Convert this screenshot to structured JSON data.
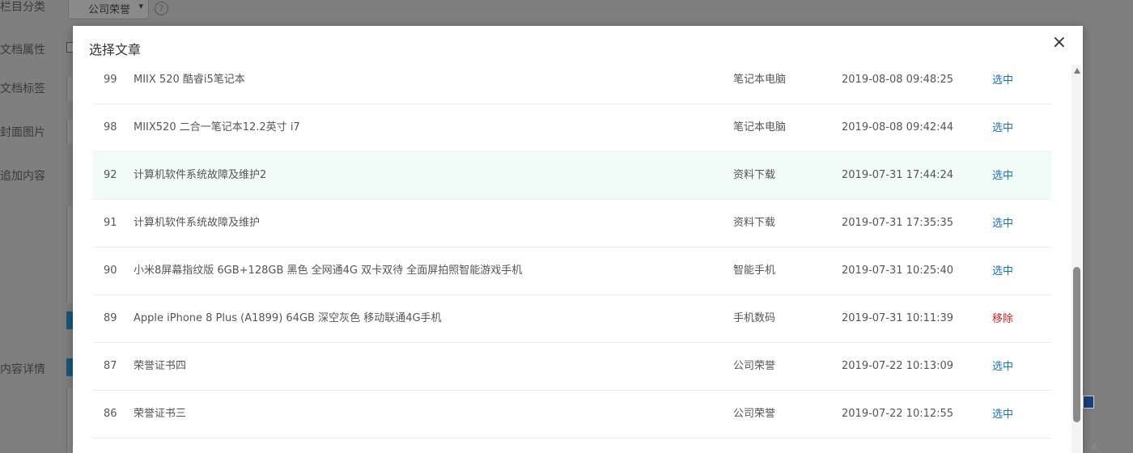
{
  "background": {
    "labels": [
      "栏目分类",
      "文档属性",
      "文档标签",
      "封面图片",
      "追加内容",
      "内容详情"
    ],
    "category_select": "公司荣誉",
    "help_icon": "question-circle-icon"
  },
  "modal": {
    "title": "选择文章",
    "close_icon": "×"
  },
  "articles": [
    {
      "id": "99",
      "title": "MIIX 520 酷睿i5笔记本",
      "category": "笔记本电脑",
      "date": "2019-08-08 09:48:25",
      "action": "选中"
    },
    {
      "id": "98",
      "title": "MIIX520 二合一笔记本12.2英寸 i7",
      "category": "笔记本电脑",
      "date": "2019-08-08 09:42:44",
      "action": "选中"
    },
    {
      "id": "92",
      "title": "计算机软件系统故障及维护2",
      "category": "资料下载",
      "date": "2019-07-31 17:44:24",
      "action": "选中"
    },
    {
      "id": "91",
      "title": "计算机软件系统故障及维护",
      "category": "资料下载",
      "date": "2019-07-31 17:35:35",
      "action": "选中"
    },
    {
      "id": "90",
      "title": "小米8屏幕指纹版 6GB+128GB 黑色 全网通4G 双卡双待 全面屏拍照智能游戏手机",
      "category": "智能手机",
      "date": "2019-07-31 10:25:40",
      "action": "选中"
    },
    {
      "id": "89",
      "title": "Apple iPhone 8 Plus (A1899) 64GB 深空灰色 移动联通4G手机",
      "category": "手机数码",
      "date": "2019-07-31 10:11:39",
      "action": "移除"
    },
    {
      "id": "87",
      "title": "荣誉证书四",
      "category": "公司荣誉",
      "date": "2019-07-22 10:13:09",
      "action": "选中"
    },
    {
      "id": "86",
      "title": "荣誉证书三",
      "category": "公司荣誉",
      "date": "2019-07-22 10:12:55",
      "action": "选中"
    }
  ],
  "colors": {
    "select_link": "#1c6fc2",
    "remove_link": "#e0201c",
    "hover_row": "#f1fbf7"
  }
}
